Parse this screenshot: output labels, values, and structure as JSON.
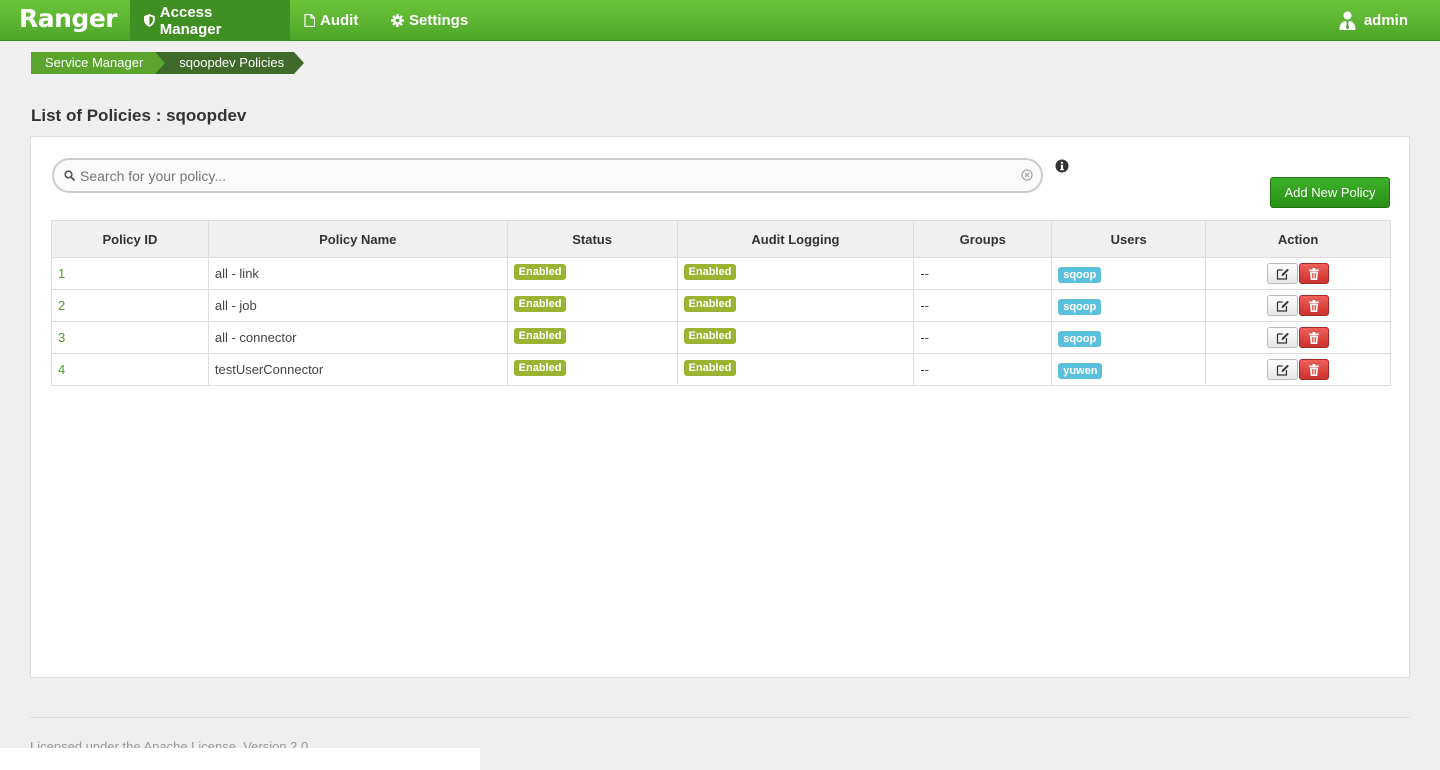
{
  "nav": {
    "brand": "Ranger",
    "items": [
      {
        "label": "Access Manager",
        "icon": "shield-icon",
        "active": true
      },
      {
        "label": "Audit",
        "icon": "file-icon",
        "active": false
      },
      {
        "label": "Settings",
        "icon": "gear-icon",
        "active": false
      }
    ],
    "user": {
      "label": "admin",
      "icon": "user-icon"
    }
  },
  "breadcrumb": {
    "items": [
      "Service Manager",
      "sqoopdev Policies"
    ]
  },
  "page": {
    "title": "List of Policies : sqoopdev"
  },
  "search": {
    "placeholder": "Search for your policy...",
    "value": ""
  },
  "toolbar": {
    "add_label": "Add New Policy"
  },
  "table": {
    "columns": [
      "Policy ID",
      "Policy Name",
      "Status",
      "Audit Logging",
      "Groups",
      "Users",
      "Action"
    ],
    "rows": [
      {
        "id": "1",
        "name": "all - link",
        "status": "Enabled",
        "audit": "Enabled",
        "groups": "--",
        "users": "sqoop"
      },
      {
        "id": "2",
        "name": "all - job",
        "status": "Enabled",
        "audit": "Enabled",
        "groups": "--",
        "users": "sqoop"
      },
      {
        "id": "3",
        "name": "all - connector",
        "status": "Enabled",
        "audit": "Enabled",
        "groups": "--",
        "users": "sqoop"
      },
      {
        "id": "4",
        "name": "testUserConnector",
        "status": "Enabled",
        "audit": "Enabled",
        "groups": "--",
        "users": "yuwen"
      }
    ]
  },
  "footer": {
    "text": "Licensed under the Apache License, Version 2.0"
  },
  "colors": {
    "brand_green": "#4ea62a",
    "enabled_label": "#99b433",
    "user_label": "#5bc0de",
    "delete_red": "#c9302c"
  }
}
